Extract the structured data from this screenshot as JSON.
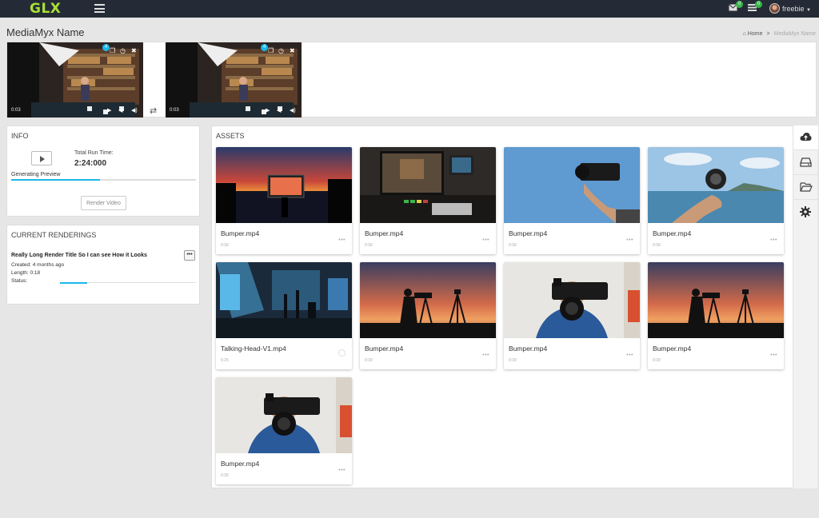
{
  "app": {
    "logo": "GLX",
    "user": "freebie",
    "mail_count": "0",
    "task_count": "0"
  },
  "page": {
    "title": "MediaMyx Name"
  },
  "breadcrumb": {
    "home": "Home",
    "separator": ">",
    "current": "MediaMyx Name"
  },
  "timeline": {
    "clips": [
      {
        "badge": "4",
        "time": "0:03"
      },
      {
        "badge": "4",
        "time": "0:03"
      }
    ]
  },
  "info": {
    "title": "INFO",
    "runtime_label": "Total Run Time:",
    "runtime_value": "2:24:000",
    "generating_label": "Generating Preview",
    "generating_progress": 0.48,
    "render_button": "Render Video"
  },
  "renderings": {
    "title": "CURRENT RENDERINGS",
    "item": {
      "title": "Really Long Render Title So I can see How it Looks",
      "created": "Created: 4 months ago",
      "length": "Length: 0:18",
      "status_label": "Status:",
      "status_progress": 0.2,
      "more": "•••"
    }
  },
  "assets": {
    "title": "ASSETS",
    "items": [
      {
        "name": "Bumper.mp4",
        "duration": "0:30",
        "more": "•••"
      },
      {
        "name": "Bumper.mp4",
        "duration": "0:30",
        "more": "•••"
      },
      {
        "name": "Bumper.mp4",
        "duration": "0:30",
        "more": "•••"
      },
      {
        "name": "Bumper.mp4",
        "duration": "0:30",
        "more": "•••"
      },
      {
        "name": "Talking-Head-V1.mp4",
        "duration": "5:25",
        "more": ""
      },
      {
        "name": "Bumper.mp4",
        "duration": "0:30",
        "more": "•••"
      },
      {
        "name": "Bumper.mp4",
        "duration": "0:30",
        "more": "•••"
      },
      {
        "name": "Bumper.mp4",
        "duration": "0:30",
        "more": "•••"
      },
      {
        "name": "Bumper.mp4",
        "duration": "0:30",
        "more": "•••"
      }
    ]
  },
  "tools": [
    "cloud-upload-icon",
    "hard-drive-icon",
    "folder-open-icon",
    "gear-icon"
  ],
  "colors": {
    "topbar": "#252b36",
    "logo": "#a8e035",
    "accent": "#1ab7ea",
    "badge": "#39b54a"
  }
}
